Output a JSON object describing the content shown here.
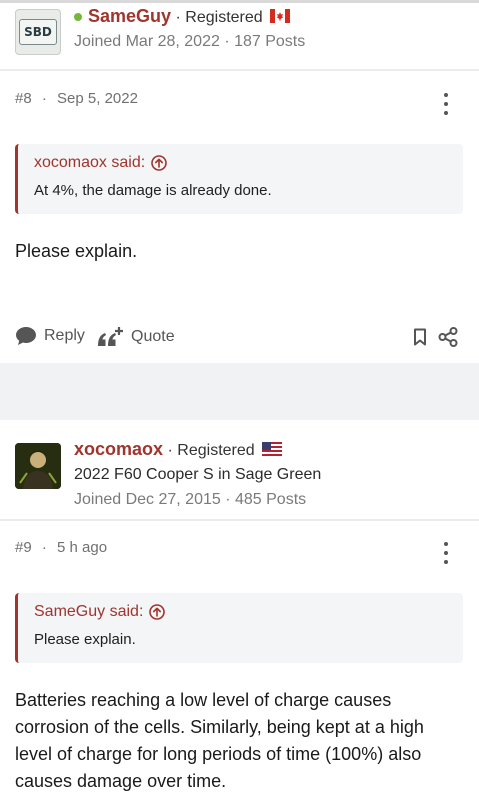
{
  "post1": {
    "username": "SameGuy",
    "separator": "·",
    "role": "Registered",
    "meta": "Joined Mar 28, 2022 · 187 Posts",
    "avatar_text": "SBD",
    "post_number": "#8",
    "post_date": "Sep 5, 2022",
    "quote_author": "xocomaox said:",
    "quote_text": "At 4%, the damage is already done.",
    "body": "Please explain.",
    "reply_label": "Reply",
    "quote_label": "Quote",
    "flag": "canada-flag-icon"
  },
  "post2": {
    "username": "xocomaox",
    "separator": "·",
    "role": "Registered",
    "subtitle": "2022 F60 Cooper S in Sage Green",
    "meta": "Joined Dec 27, 2015 · 485 Posts",
    "post_number": "#9",
    "post_date": "5 h ago",
    "quote_author": "SameGuy said:",
    "quote_text": "Please explain.",
    "body": "Batteries reaching a low level of charge causes corrosion of the cells. Similarly, being kept at a high level of charge for long periods of time (100%) also causes damage over time.",
    "flag": "usa-flag-icon"
  },
  "colors": {
    "accent": "#a0352e",
    "online": "#73b839",
    "meta_gray": "#7a7a7a",
    "quote_bg": "#f4f5f7"
  }
}
